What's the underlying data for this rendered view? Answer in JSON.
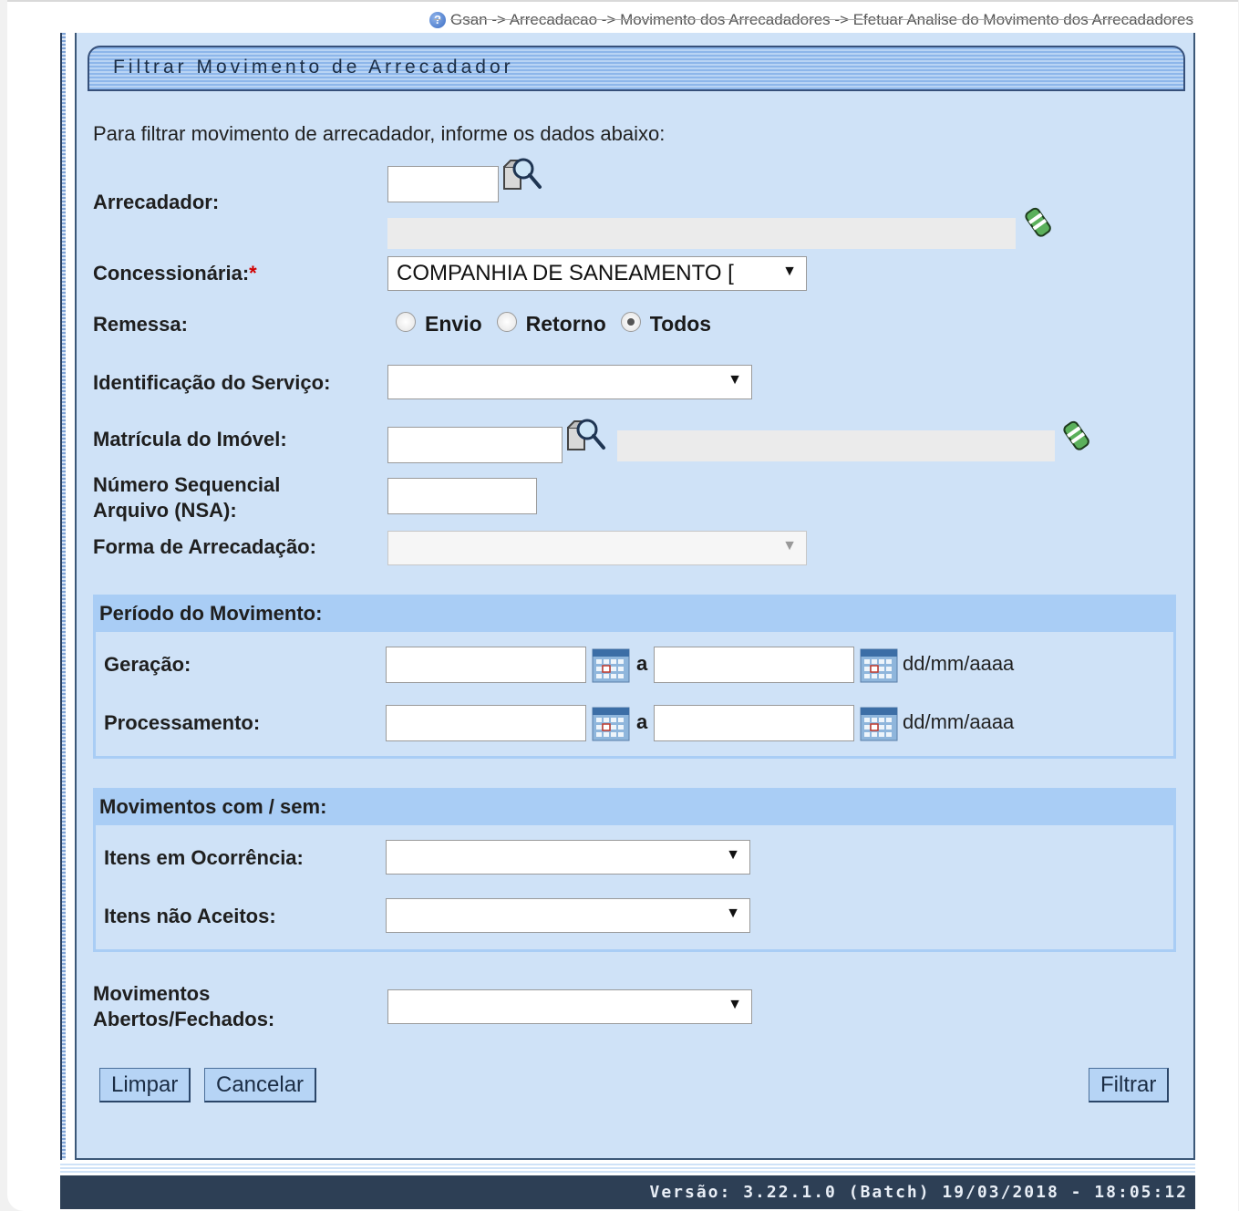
{
  "breadcrumb": {
    "help_icon": "?",
    "text": "Gsan -> Arrecadacao -> Movimento dos Arrecadadores -> Efetuar Analise do Movimento dos Arrecadadores"
  },
  "title": "Filtrar Movimento de Arrecadador",
  "intro": "Para filtrar movimento de arrecadador, informe os dados abaixo:",
  "fields": {
    "arrecadador": {
      "label": "Arrecadador:",
      "value": "",
      "description": ""
    },
    "concessionaria": {
      "label": "Concessionária:",
      "required_mark": "*",
      "selected": "COMPANHIA DE SANEAMENTO ["
    },
    "remessa": {
      "label": "Remessa:",
      "options": [
        "Envio",
        "Retorno",
        "Todos"
      ],
      "selected": "Todos"
    },
    "identificacao_servico": {
      "label": "Identificação do Serviço:",
      "selected": ""
    },
    "matricula_imovel": {
      "label": "Matrícula do Imóvel:",
      "value": "",
      "description": ""
    },
    "nsa": {
      "label_line1": "Número Sequencial",
      "label_line2": "Arquivo (NSA):",
      "value": ""
    },
    "forma_arrecadacao": {
      "label": "Forma de Arrecadação:",
      "selected": "",
      "disabled": true
    }
  },
  "periodo": {
    "header": "Período do Movimento:",
    "separator": "a",
    "format_hint": "dd/mm/aaaa",
    "geracao": {
      "label": "Geração:",
      "from": "",
      "to": ""
    },
    "processamento": {
      "label": "Processamento:",
      "from": "",
      "to": ""
    }
  },
  "movimentos": {
    "header": "Movimentos com / sem:",
    "itens_ocorrencia": {
      "label": "Itens em Ocorrência:",
      "selected": ""
    },
    "itens_nao_aceitos": {
      "label": "Itens não Aceitos:",
      "selected": ""
    }
  },
  "abertos_fechados": {
    "label_line1": "Movimentos",
    "label_line2": "Abertos/Fechados:",
    "selected": ""
  },
  "buttons": {
    "limpar": "Limpar",
    "cancelar": "Cancelar",
    "filtrar": "Filtrar"
  },
  "footer": "Versão: 3.22.1.0 (Batch) 19/03/2018 - 18:05:12",
  "icons": {
    "search": "magnifier-search-icon",
    "erase": "eraser-icon",
    "calendar": "calendar-icon",
    "dropdown": "triangle-down"
  },
  "colors": {
    "panel_bg": "#cfe2f7",
    "group_header": "#a9cdf5",
    "footer_bg": "#2d3f55",
    "button_bg": "#b6d4f5",
    "required": "#d10000"
  }
}
